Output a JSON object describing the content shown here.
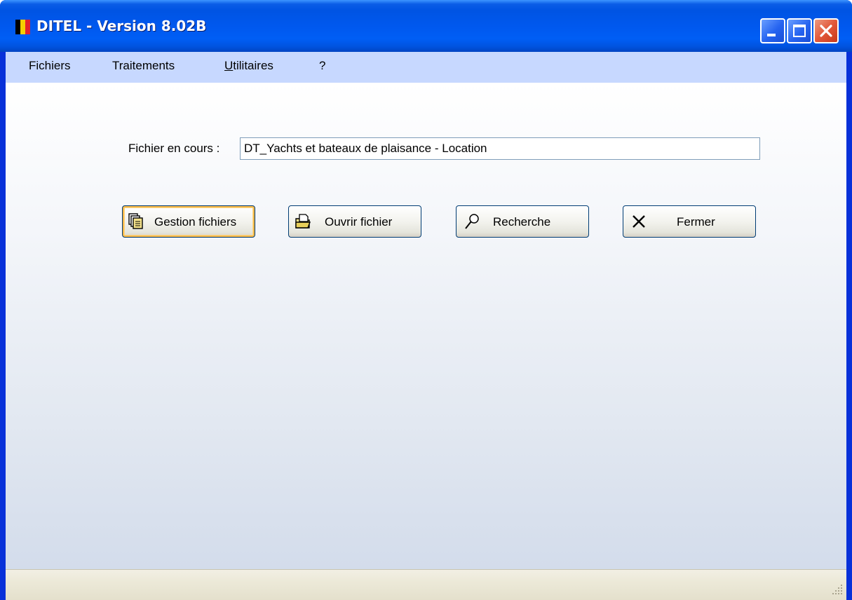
{
  "window": {
    "title": "DITEL - Version 8.02B",
    "icon": "belgian-flag-icon",
    "flag_colors": [
      "#000000",
      "#f5d000",
      "#e4222c"
    ]
  },
  "titlebar_buttons": {
    "minimize_icon": "minimize-icon",
    "maximize_icon": "maximize-icon",
    "close_icon": "close-icon"
  },
  "menu": {
    "items": [
      {
        "label": "Fichiers"
      },
      {
        "label": "Traitements"
      },
      {
        "label_first": "U",
        "label_rest": "tilitaires"
      },
      {
        "label": "?"
      }
    ]
  },
  "main": {
    "file_label": "Fichier en cours :",
    "file_value": "DT_Yachts et bateaux de plaisance - Location"
  },
  "buttons": {
    "gestion": {
      "label": "Gestion fichiers",
      "icon": "files-stack-icon"
    },
    "ouvrir": {
      "label": "Ouvrir fichier",
      "icon": "open-folder-icon"
    },
    "recherche": {
      "label": "Recherche",
      "icon": "magnifier-icon"
    },
    "fermer": {
      "label": "Fermer",
      "icon": "x-close-icon"
    }
  },
  "colors": {
    "titlebar": "#0054e3",
    "menubar": "#c7d8ff",
    "focus_accent": "#f7b94a"
  }
}
